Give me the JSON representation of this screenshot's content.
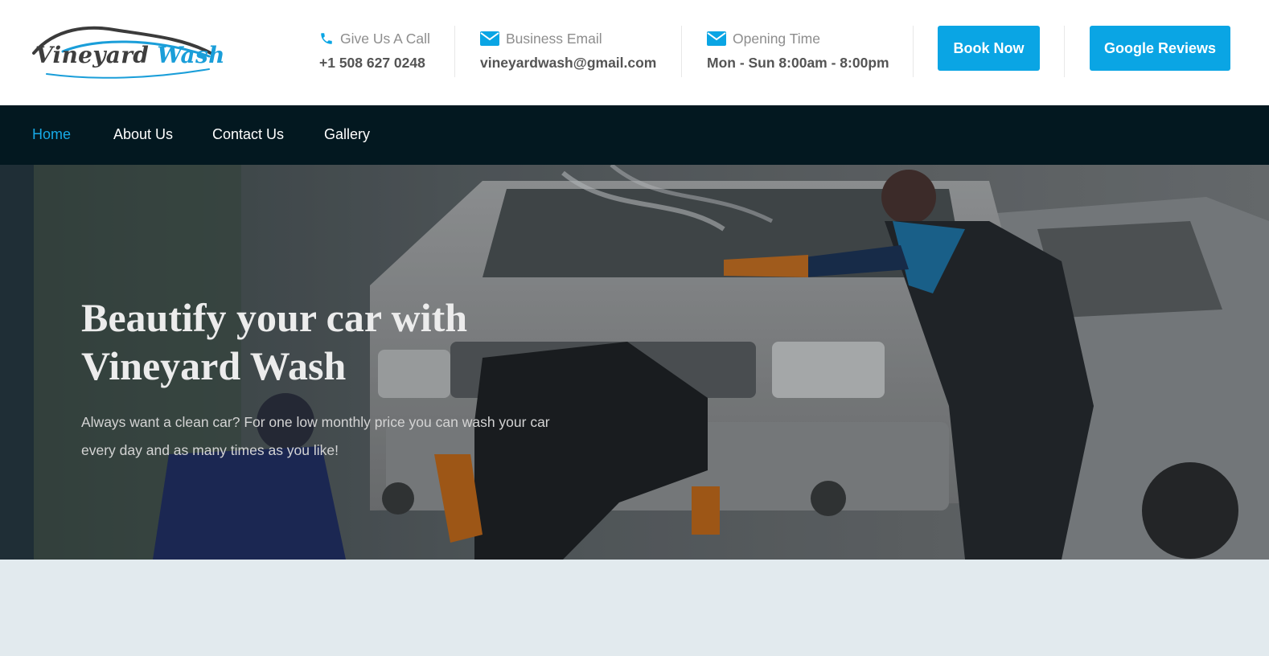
{
  "brand": {
    "logo_word1": "Vineyard",
    "logo_word2": "Wash"
  },
  "header": {
    "call": {
      "label": "Give Us A Call",
      "value": "+1 508 627 0248",
      "icon": "phone-icon"
    },
    "email": {
      "label": "Business Email",
      "value": "vineyardwash@gmail.com",
      "icon": "envelope-icon"
    },
    "hours": {
      "label": "Opening Time",
      "value": "Mon - Sun 8:00am - 8:00pm",
      "icon": "envelope-icon"
    },
    "book_button": "Book Now",
    "reviews_button": "Google Reviews"
  },
  "nav": {
    "items": [
      {
        "label": "Home",
        "active": true
      },
      {
        "label": "About Us",
        "active": false
      },
      {
        "label": "Contact Us",
        "active": false
      },
      {
        "label": "Gallery",
        "active": false
      }
    ]
  },
  "hero": {
    "title": "Beautify your car with Vineyard Wash",
    "subtitle": "Always want a clean car? For one low monthly price you can wash your car every day and as many times as you like!"
  },
  "colors": {
    "accent": "#0aa5e4",
    "nav_background": "#031820",
    "page_background": "#e2eaee"
  }
}
